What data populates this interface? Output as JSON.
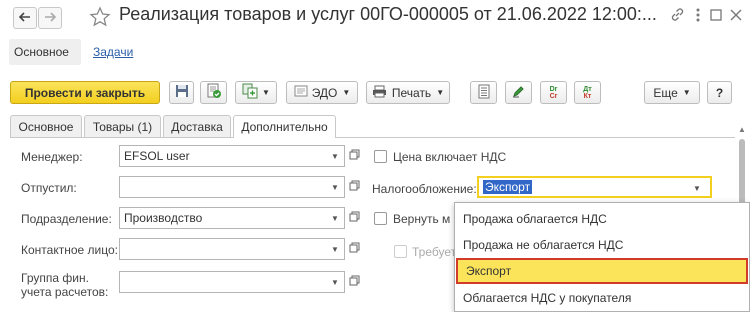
{
  "window": {
    "title": "Реализация товаров и услуг 00ГО-000005 от 21.06.2022 12:00:..."
  },
  "icons": {
    "back": "arrow-left-icon",
    "forward": "arrow-right-icon",
    "favorite": "star-icon",
    "link": "link-icon",
    "menu": "more-vertical-icon",
    "maximize": "maximize-icon",
    "close": "close-icon"
  },
  "nav": {
    "main": "Основное",
    "tasks": "Задачи"
  },
  "toolbar": {
    "post_close": "Провести и закрыть",
    "edo": "ЭДО",
    "print": "Печать",
    "more": "Еще",
    "help": "?"
  },
  "tabs": [
    {
      "label": "Основное"
    },
    {
      "label": "Товары (1)"
    },
    {
      "label": "Доставка"
    },
    {
      "label": "Дополнительно"
    }
  ],
  "form": {
    "manager_label": "Менеджер:",
    "manager_value": "EFSOL user",
    "released_label": "Отпустил:",
    "released_value": "",
    "division_label": "Подразделение:",
    "division_value": "Производство",
    "contact_label": "Контактное лицо:",
    "contact_value": "",
    "group_label_1": "Группа фин.",
    "group_label_2": "учета расчетов:",
    "group_value": "",
    "price_vat_label": "Цена включает НДС",
    "taxation_label": "Налогообложение:",
    "taxation_value": "Экспорт",
    "return_label": "Вернуть м",
    "requires_label": "Требует"
  },
  "dropdown": {
    "options": [
      "Продажа облагается НДС",
      "Продажа не облагается НДС",
      "Экспорт",
      "Облагается НДС у покупателя"
    ],
    "selected": "Экспорт"
  },
  "colors": {
    "accent_yellow": "#f3cf1f",
    "selection_border": "#d23a2a",
    "link_blue": "#2a5ea8"
  }
}
